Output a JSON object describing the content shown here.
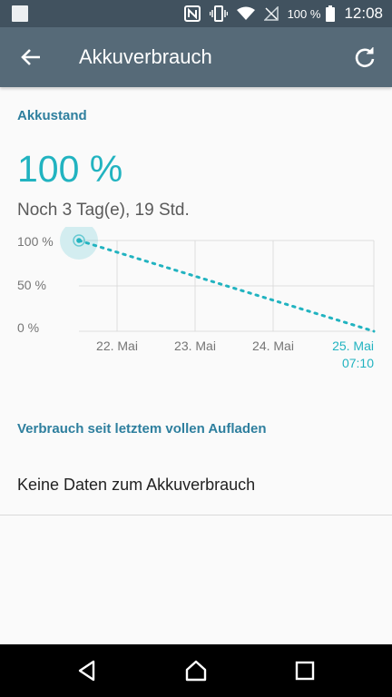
{
  "status_bar": {
    "battery_percent": "100 %",
    "time": "12:08",
    "icons": [
      "notification-square-icon",
      "nfc-icon",
      "vibrate-icon",
      "wifi-icon",
      "no-signal-icon",
      "battery-icon"
    ]
  },
  "app_bar": {
    "title": "Akkuverbrauch",
    "back_icon": "arrow-left-icon",
    "refresh_icon": "refresh-icon"
  },
  "battery_status": {
    "section_title": "Akkustand",
    "level": "100 %",
    "remaining": "Noch 3 Tag(e), 19 Std."
  },
  "chart_data": {
    "type": "line",
    "y_tick_labels": [
      "100 %",
      "50 %",
      "0 %"
    ],
    "ylim": [
      0,
      100
    ],
    "x_tick_labels": [
      "22. Mai",
      "23. Mai",
      "24. Mai",
      "25. Mai"
    ],
    "x_tick_sublabel": "07:10",
    "highlighted_x_label": "25. Mai",
    "series": [
      {
        "style": "dotted",
        "points": [
          {
            "x": "21. Mai 12:08",
            "y": 100
          },
          {
            "x": "25. Mai 07:10",
            "y": 0
          }
        ]
      }
    ],
    "grid": true,
    "accent_color": "#21b3c0"
  },
  "usage": {
    "section_title": "Verbrauch seit letztem vollen Aufladen",
    "empty_text": "Keine Daten zum Akkuverbrauch"
  },
  "nav_bar": {
    "back_icon": "nav-back-icon",
    "home_icon": "nav-home-icon",
    "recents_icon": "nav-recents-icon"
  },
  "colors": {
    "status_bar": "#41525f",
    "app_bar": "#566a78",
    "accent": "#21b3c0",
    "section_title": "#2e7f9e"
  }
}
